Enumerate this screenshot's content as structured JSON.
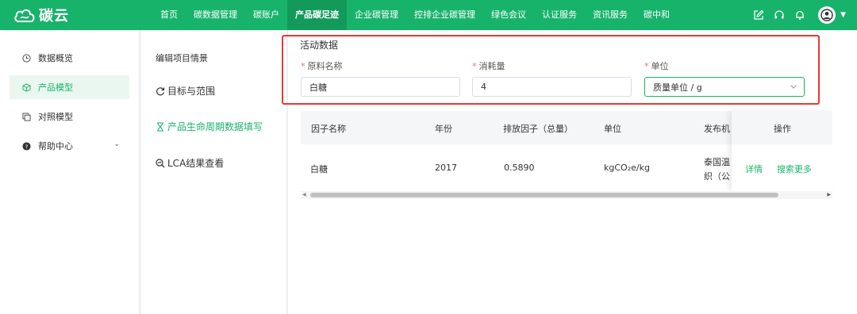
{
  "app": {
    "logo_text": "碳云"
  },
  "nav": {
    "items": [
      "首页",
      "碳数据管理",
      "碳账户",
      "产品碳足迹",
      "企业碳管理",
      "控排企业碳管理",
      "绿色会议",
      "认证服务",
      "资讯服务",
      "碳中和"
    ],
    "active_index": 3
  },
  "topbar_icons": [
    "edit-icon",
    "headset-icon",
    "bell-icon",
    "user-avatar-icon",
    "caret-down-icon"
  ],
  "sidebar": {
    "items": [
      {
        "label": "数据概览",
        "icon": "clock-icon"
      },
      {
        "label": "产品模型",
        "icon": "cube-icon"
      },
      {
        "label": "对照模型",
        "icon": "copy-icon"
      },
      {
        "label": "帮助中心",
        "icon": "question-icon"
      }
    ],
    "active_index": 1
  },
  "steps": {
    "title": "编辑项目情景",
    "items": [
      {
        "label": "目标与范围",
        "icon": "cycle-icon"
      },
      {
        "label": "产品生命周期数据填写",
        "icon": "hourglass-icon"
      },
      {
        "label": "LCA结果查看",
        "icon": "search-chart-icon"
      }
    ],
    "active_index": 1
  },
  "activity": {
    "title": "活动数据",
    "fields": {
      "material_name": {
        "label": "原料名称",
        "value": "白糖"
      },
      "consumption": {
        "label": "消耗量",
        "value": "4"
      },
      "unit": {
        "label": "单位",
        "value": "质量单位 / g"
      }
    }
  },
  "table": {
    "columns": [
      "因子名称",
      "年份",
      "排放因子（总量）",
      "单位",
      "发布机",
      "操作"
    ],
    "rows": [
      {
        "name": "白糖",
        "year": "2017",
        "factor": "0.5890",
        "unit": "kgCO₂e/kg",
        "publisher_line1": "泰国温",
        "publisher_line2": "织（公",
        "actions": [
          "详情",
          "搜索更多"
        ]
      }
    ]
  },
  "colors": {
    "brand": "#18b36b",
    "highlight_border": "#e53935",
    "required": "#f56c6c"
  }
}
